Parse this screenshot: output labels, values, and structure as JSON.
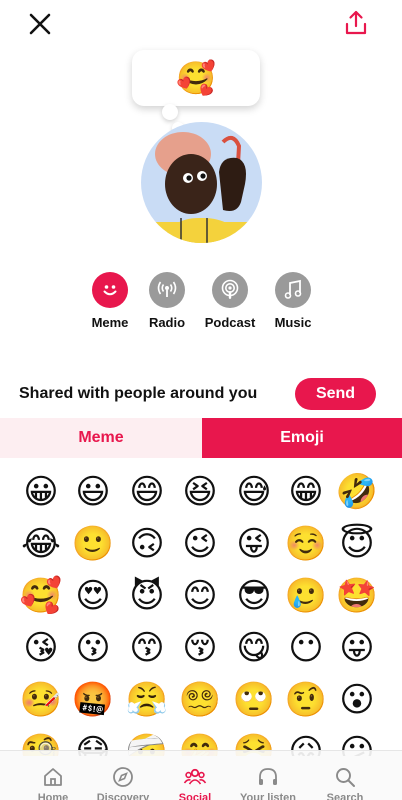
{
  "top": {
    "close_icon": "close-icon",
    "share_icon": "share-upload-icon"
  },
  "bubble": {
    "emoji": "🥰"
  },
  "avatar": {
    "description_icon": "user-avatar"
  },
  "modes": [
    {
      "label": "Meme",
      "icon": "smiley-icon",
      "active": true,
      "color": "#e8174d"
    },
    {
      "label": "Radio",
      "icon": "broadcast-icon",
      "active": false,
      "color": "#9a9a9a"
    },
    {
      "label": "Podcast",
      "icon": "podcast-icon",
      "active": false,
      "color": "#9a9a9a"
    },
    {
      "label": "Music",
      "icon": "music-note-icon",
      "active": false,
      "color": "#9a9a9a"
    }
  ],
  "shared": {
    "text": "Shared with people around you",
    "send_label": "Send"
  },
  "tabs": [
    {
      "label": "Meme",
      "active": false
    },
    {
      "label": "Emoji",
      "active": true
    }
  ],
  "emojis": [
    [
      "😀",
      "😃",
      "😄",
      "😆",
      "😅",
      "😁",
      "🤣"
    ],
    [
      "😂",
      "🙂",
      "🙃",
      "😉",
      "😜",
      "☺️",
      "😇"
    ],
    [
      "🥰",
      "😍",
      "😈",
      "😊",
      "😎",
      "🥲",
      "🤩"
    ],
    [
      "😘",
      "😗",
      "😙",
      "😚",
      "😋",
      "😶",
      "😛"
    ],
    [
      "🤒",
      "🤬",
      "😤",
      "😵‍💫",
      "🙄",
      "🤨",
      "😮"
    ],
    [
      "🧐",
      "😷",
      "🤕",
      "🤭",
      "🤮",
      "😖",
      "😕"
    ]
  ],
  "bottom_nav": [
    {
      "label": "Home",
      "icon": "home-icon",
      "active": false
    },
    {
      "label": "Discovery",
      "icon": "compass-icon",
      "active": false
    },
    {
      "label": "Social",
      "icon": "people-icon",
      "active": true
    },
    {
      "label": "Your listen",
      "icon": "headphones-icon",
      "active": false
    },
    {
      "label": "Search",
      "icon": "search-icon",
      "active": false
    }
  ],
  "colors": {
    "accent": "#e8174d",
    "accent_light": "#fdeef1",
    "inactive": "#9a9a9a"
  }
}
